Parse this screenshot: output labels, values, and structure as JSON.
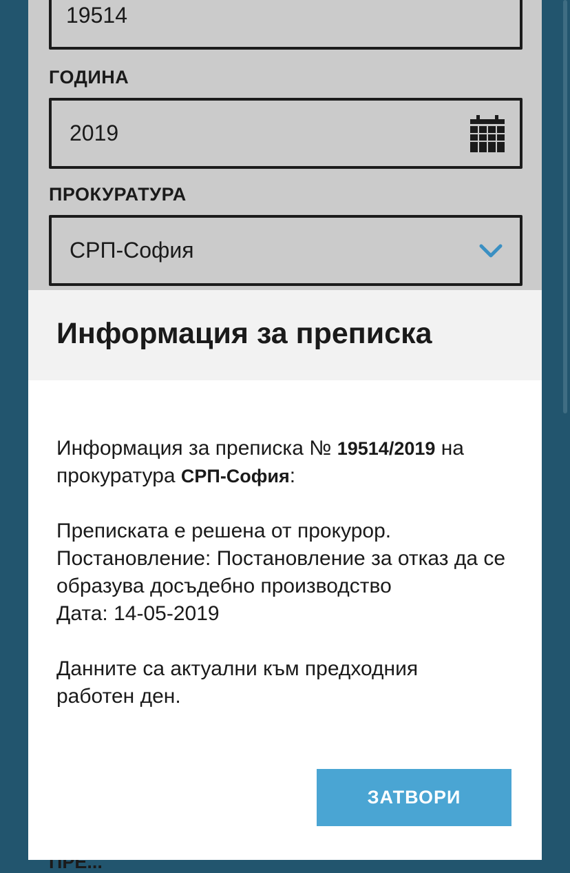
{
  "form": {
    "number_value": "19514",
    "year_label": "ГОДИНА",
    "year_value": "2019",
    "prosecution_label": "ПРОКУРАТУРА",
    "prosecution_value": "СРП-София",
    "behind_text": "ПРЕ..."
  },
  "modal": {
    "title": "Информация за преписка",
    "line1_prefix": "Информация за преписка № ",
    "case_number": "19514/2019",
    "line1_mid": " на",
    "line2_prefix": "прокуратура ",
    "prosecution": "СРП-София",
    "line2_suffix": ":",
    "status": "Преписката е решена от прокурор.",
    "decision": "Постановление: Постановление за отказ да се образува досъдебно производство",
    "date": "Дата: 14-05-2019",
    "note": "Данните са актуални към предходния работен ден.",
    "close_label": "ЗАТВОРИ"
  },
  "icons": {
    "calendar": "calendar-icon",
    "dropdown": "chevron-down-icon"
  },
  "colors": {
    "background": "#22556e",
    "panel": "#cbcbcb",
    "button": "#4aa5d3",
    "chevron": "#3a8fc2"
  }
}
